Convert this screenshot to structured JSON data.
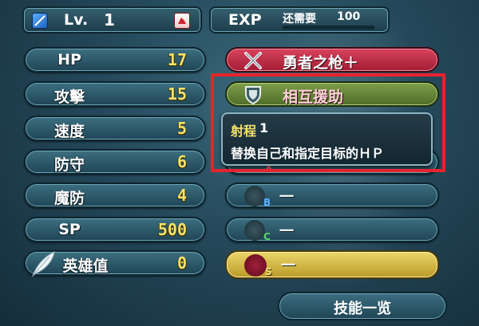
{
  "header": {
    "level_label": "Lv.",
    "level_value": "1",
    "exp_label": "EXP",
    "exp_remaining_label": "还需要",
    "exp_remaining_value": "100"
  },
  "stats": [
    {
      "label": "HP",
      "value": "17"
    },
    {
      "label": "攻擊",
      "value": "15"
    },
    {
      "label": "速度",
      "value": "5"
    },
    {
      "label": "防守",
      "value": "6"
    },
    {
      "label": "魔防",
      "value": "4"
    },
    {
      "label": "SP",
      "value": "500"
    },
    {
      "label": "英雄值",
      "value": "0"
    }
  ],
  "skills": {
    "weapon": "勇者之枪＋",
    "assist": "相互援助",
    "slot_a": "一",
    "slot_b": "一",
    "slot_c": "一",
    "slot_s": "一",
    "slot_a_letter": "A",
    "slot_b_letter": "B",
    "slot_c_letter": "C",
    "slot_s_letter": "S"
  },
  "tooltip": {
    "range_label": "射程",
    "range_value": "1",
    "description": "替换自己和指定目标的ＨＰ"
  },
  "footer": {
    "skill_list_button": "技能一览"
  },
  "colors": {
    "stat_value": "#f4e36a",
    "weapon_slot": "#c3304a",
    "assist_slot": "#5e7f35",
    "seal_slot": "#d8c04a",
    "highlight_frame": "#e8232e"
  }
}
